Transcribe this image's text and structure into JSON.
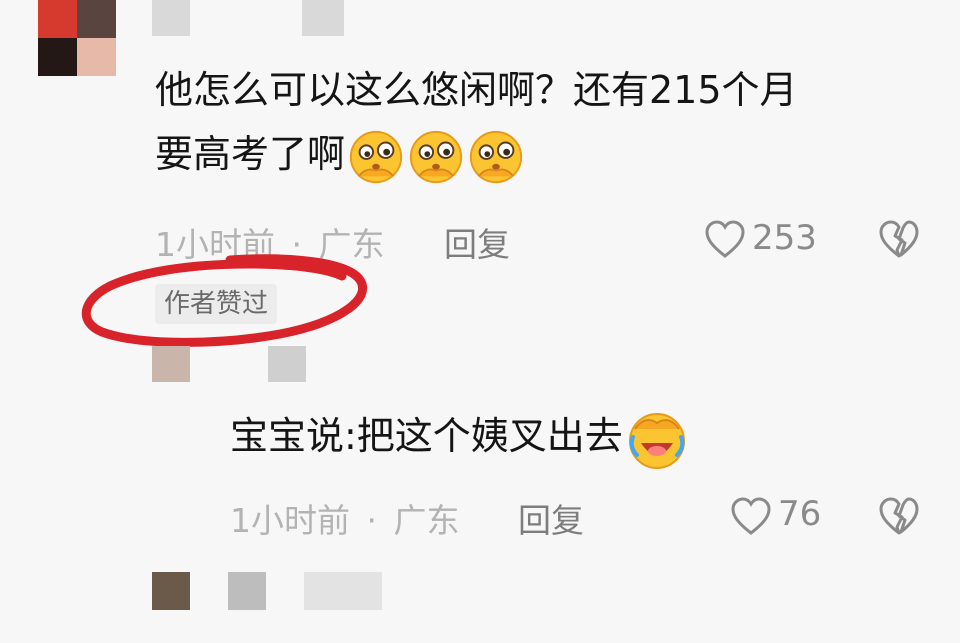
{
  "comment1": {
    "line1": "他怎么可以这么悠闲啊？还有215个月",
    "line2": "要高考了啊",
    "time": "1小时前",
    "dot": "·",
    "location": "广东",
    "reply": "回复",
    "likes": "253",
    "badge": "作者赞过",
    "emojis": [
      "thinking-face-emoji",
      "thinking-face-emoji",
      "thinking-face-emoji"
    ]
  },
  "comment2": {
    "text": "宝宝说:把这个姨叉出去",
    "time": "1小时前",
    "dot": "·",
    "location": "广东",
    "reply": "回复",
    "likes": "76",
    "emoji": "laughing-crying-emoji"
  },
  "colors": {
    "background": "#f7f7f7",
    "text": "#151515",
    "meta": "#b3b3b3",
    "annotation_red": "#d8232a"
  }
}
